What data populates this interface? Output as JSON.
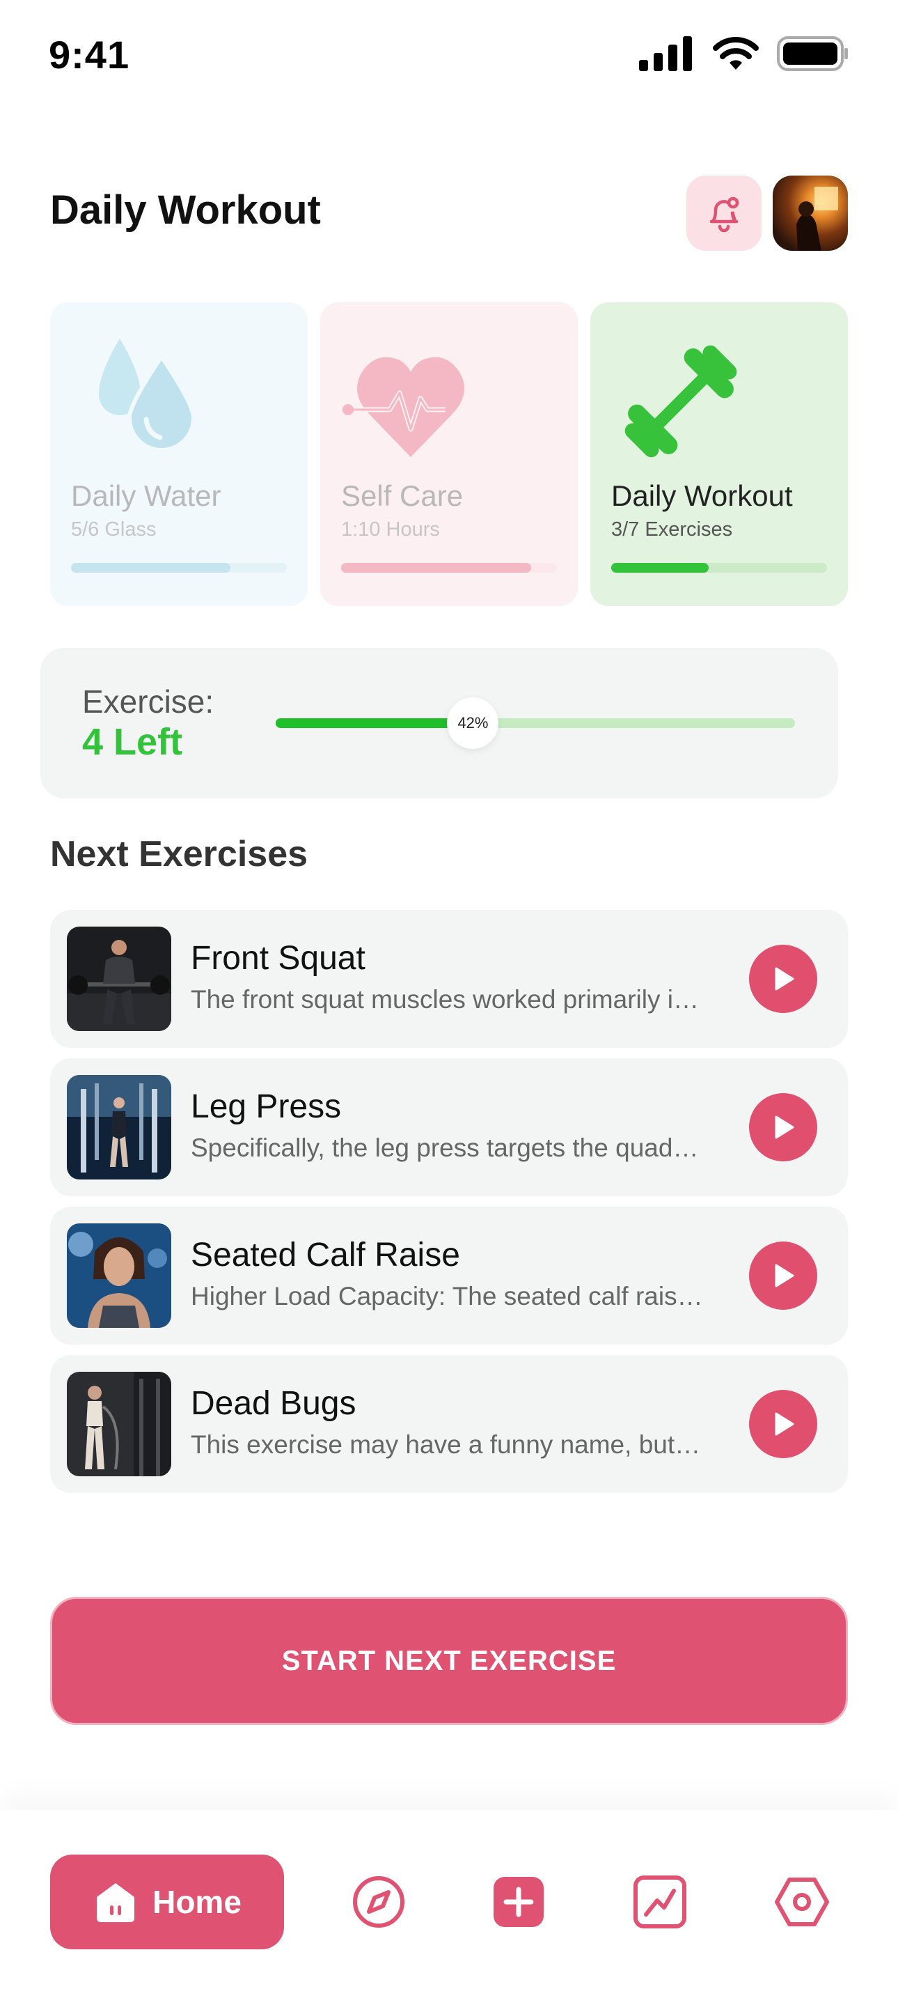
{
  "status_bar": {
    "time": "9:41",
    "icons": [
      "signal-icon",
      "wifi-icon",
      "battery-icon"
    ]
  },
  "header": {
    "title": "Daily Workout",
    "bell_icon": "bell-icon",
    "avatar": "user-avatar"
  },
  "stats": [
    {
      "label": "Daily Water",
      "sub": "5/6 Glass",
      "progress": 0.74,
      "icon": "water-drops-icon"
    },
    {
      "label": "Self Care",
      "sub": "1:10 Hours",
      "progress": 0.88,
      "icon": "heartbeat-icon"
    },
    {
      "label": "Daily Workout",
      "sub": "3/7 Exercises",
      "progress": 0.45,
      "icon": "dumbbell-icon"
    }
  ],
  "exercise_progress": {
    "caption": "Exercise:",
    "value": "4 Left",
    "percent_label": "42%",
    "percent": 0.38
  },
  "next_exercises": {
    "title": "Next Exercises",
    "items": [
      {
        "title": "Front Squat",
        "desc": "The front squat muscles worked primarily include the quads, glutes and core"
      },
      {
        "title": "Leg Press",
        "desc": "Specifically, the leg press targets the quadriceps, hamstrings and glutes"
      },
      {
        "title": "Seated Calf Raise",
        "desc": "Higher Load Capacity: The seated calf raise allows you to use heavier loads"
      },
      {
        "title": "Dead Bugs",
        "desc": "This exercise may have a funny name, but it strengthens your core"
      }
    ]
  },
  "cta": {
    "label": "START NEXT EXERCISE"
  },
  "bottom_nav": {
    "home_label": "Home",
    "items": [
      "home-icon",
      "compass-icon",
      "plus-icon",
      "chart-icon",
      "settings-icon"
    ]
  },
  "colors": {
    "accent": "#e05271",
    "green": "#33c33b",
    "card_water": "#f1f9fc",
    "card_care": "#fdf0f2",
    "card_workout": "#e2f4df"
  }
}
